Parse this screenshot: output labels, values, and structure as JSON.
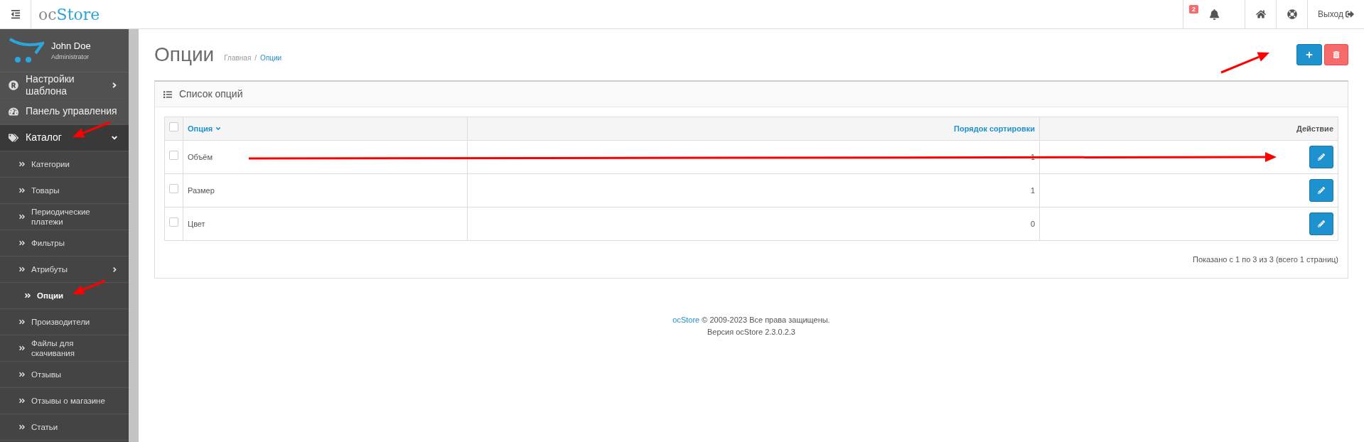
{
  "header": {
    "logo": {
      "prefix": "oc",
      "name": "Store"
    },
    "notifications": {
      "count": "2"
    },
    "logout": "Выход"
  },
  "user": {
    "name": "John Doe",
    "role": "Administrator"
  },
  "sidebar": {
    "items": [
      {
        "label": "Настройки шаблона",
        "expanded": false,
        "has_submenu": true
      },
      {
        "label": "Панель управления",
        "expanded": false,
        "has_submenu": false
      },
      {
        "label": "Каталог",
        "expanded": true,
        "has_submenu": true,
        "children": [
          {
            "label": "Категории",
            "selected": false,
            "has_submenu": false
          },
          {
            "label": "Товары",
            "selected": false,
            "has_submenu": false
          },
          {
            "label": "Периодические платежи",
            "selected": false,
            "has_submenu": false
          },
          {
            "label": "Фильтры",
            "selected": false,
            "has_submenu": false
          },
          {
            "label": "Атрибуты",
            "selected": false,
            "has_submenu": true
          },
          {
            "label": "Опции",
            "selected": true,
            "has_submenu": false
          },
          {
            "label": "Производители",
            "selected": false,
            "has_submenu": false
          },
          {
            "label": "Файлы для скачивания",
            "selected": false,
            "has_submenu": false
          },
          {
            "label": "Отзывы",
            "selected": false,
            "has_submenu": false
          },
          {
            "label": "Отзывы о магазине",
            "selected": false,
            "has_submenu": false
          },
          {
            "label": "Статьи",
            "selected": false,
            "has_submenu": false
          }
        ]
      }
    ]
  },
  "page": {
    "title": "Опции",
    "breadcrumb_separator": "/",
    "breadcrumbs": [
      {
        "label": "Главная",
        "current": false
      },
      {
        "label": "Опции",
        "current": true
      }
    ]
  },
  "panel": {
    "title": "Список опций",
    "table": {
      "select_all": {
        "checked": false
      },
      "columns": [
        {
          "label": "Опция",
          "sorted": true,
          "link": true
        },
        {
          "label": "Порядок сортировки",
          "sorted": false,
          "link": true
        },
        {
          "label": "Действие",
          "sorted": false,
          "link": false
        }
      ],
      "rows": [
        {
          "checked": false,
          "name": "Объём",
          "sort_order": "1"
        },
        {
          "checked": false,
          "name": "Размер",
          "sort_order": "1"
        },
        {
          "checked": false,
          "name": "Цвет",
          "sort_order": "0"
        }
      ]
    },
    "pagination": "Показано с 1 по 3 из 3 (всего 1 страниц)"
  },
  "footer": {
    "link": "ocStore",
    "text": " © 2009-2023 Все права защищены.",
    "version": "Версия ocStore 2.3.0.2.3"
  }
}
